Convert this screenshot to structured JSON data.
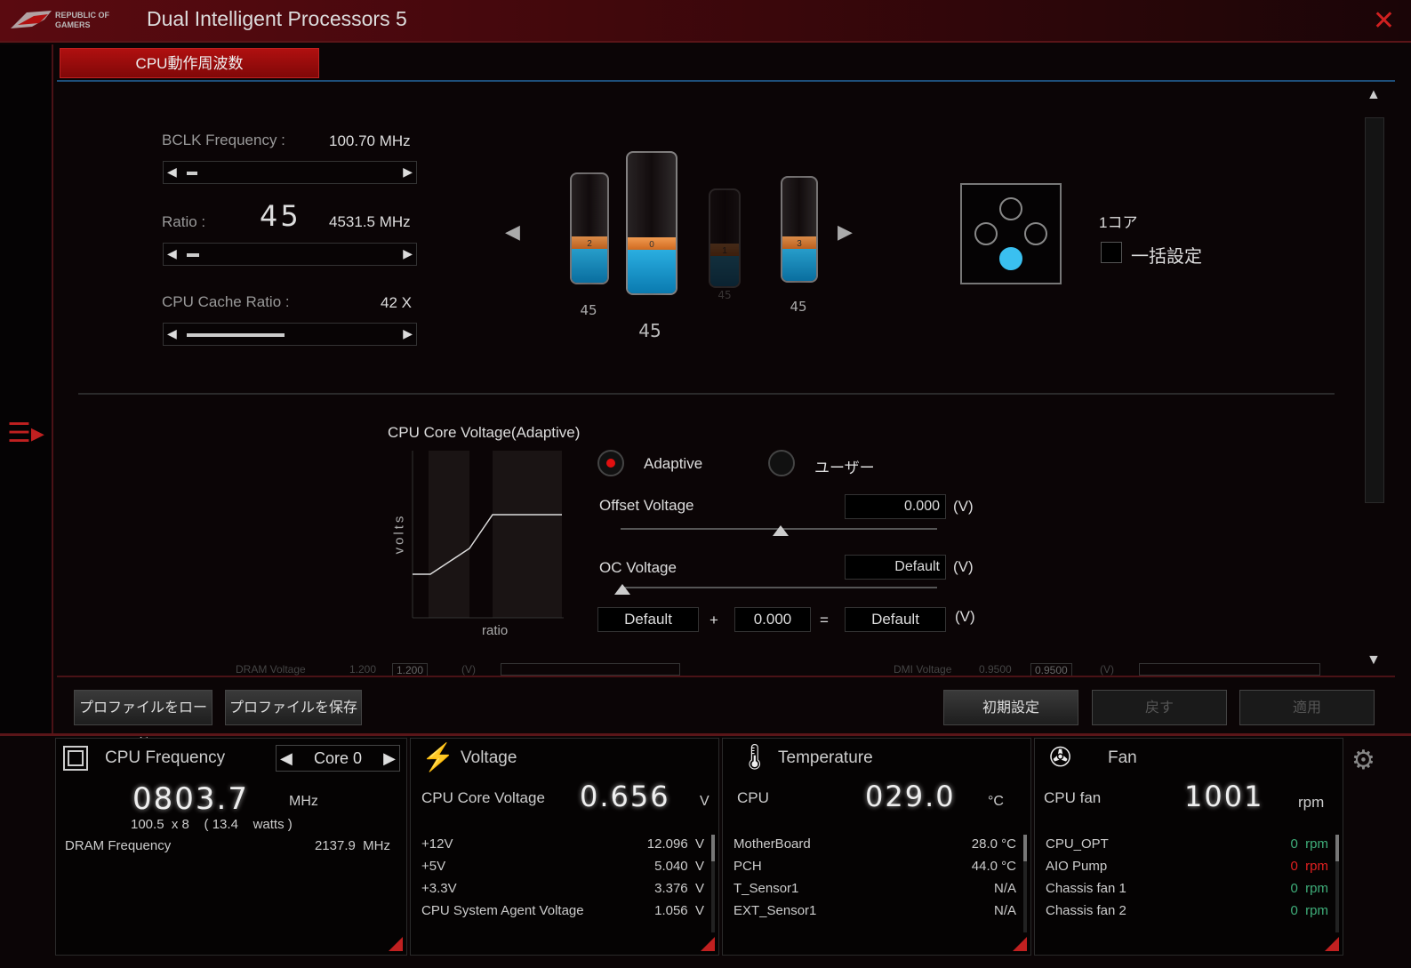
{
  "app": {
    "title": "Dual Intelligent Processors 5",
    "logo_line1": "REPUBLIC OF",
    "logo_line2": "GAMERS"
  },
  "tab": {
    "label": "CPU動作周波数"
  },
  "freq": {
    "bclk_label": "BCLK Frequency :",
    "bclk_value": "100.70 MHz",
    "ratio_label": "Ratio :",
    "ratio_value": "45",
    "ratio_mhz": "4531.5 MHz",
    "cache_label": "CPU Cache Ratio :",
    "cache_value": "42 X"
  },
  "cores": [
    {
      "index": "2",
      "ratio": "45",
      "fill": 0.3
    },
    {
      "index": "0",
      "ratio": "45",
      "fill": 0.3
    },
    {
      "index": "1",
      "ratio": "45",
      "fill": 0.3
    },
    {
      "index": "3",
      "ratio": "45",
      "fill": 0.3
    }
  ],
  "core_select": {
    "label": "1コア",
    "checkbox_label": "一括設定"
  },
  "voltage": {
    "title": "CPU Core Voltage(Adaptive)",
    "ylabel": "volts",
    "xlabel": "ratio",
    "mode_adaptive": "Adaptive",
    "mode_user": "ユーザー",
    "offset_label": "Offset Voltage",
    "offset_value": "0.000",
    "unit": "(V)",
    "oc_label": "OC Voltage",
    "oc_value": "Default",
    "sum_a": "Default",
    "plus": "+",
    "sum_b": "0.000",
    "equals": "=",
    "sum_c": "Default"
  },
  "cut_row": {
    "dram_label": "DRAM Voltage",
    "dram_value": "1.200",
    "dram_box": "1.200",
    "dmi_label": "DMI Voltage",
    "dmi_value": "0.9500",
    "dmi_box": "0.9500",
    "unit": "(V)"
  },
  "buttons": {
    "load": "プロファイルをロード",
    "save": "プロファイルを保存",
    "default": "初期設定",
    "undo": "戻す",
    "apply": "適用"
  },
  "monitor": {
    "cpu": {
      "title": "CPU Frequency",
      "core_sel": "Core 0",
      "value": "0803.7",
      "unit": "MHz",
      "detail": "100.5  x 8    ( 13.4    watts )",
      "dram_label": "DRAM Frequency",
      "dram_value": "2137.9  MHz"
    },
    "volt": {
      "title": "Voltage",
      "main_label": "CPU Core Voltage",
      "main_value": "0.656",
      "main_unit": "V",
      "rows": [
        {
          "label": "+12V",
          "value": "12.096  V"
        },
        {
          "label": "+5V",
          "value": "5.040  V"
        },
        {
          "label": "+3.3V",
          "value": "3.376  V"
        },
        {
          "label": "CPU System Agent Voltage",
          "value": "1.056  V"
        }
      ]
    },
    "temp": {
      "title": "Temperature",
      "main_label": "CPU",
      "main_value": "029.0",
      "main_unit": "°C",
      "rows": [
        {
          "label": "MotherBoard",
          "value": "28.0 °C"
        },
        {
          "label": "PCH",
          "value": "44.0 °C"
        },
        {
          "label": "T_Sensor1",
          "value": "N/A"
        },
        {
          "label": "EXT_Sensor1",
          "value": "N/A"
        }
      ]
    },
    "fan": {
      "title": "Fan",
      "main_label": "CPU fan",
      "main_value": "1001",
      "main_unit": "rpm",
      "rows": [
        {
          "label": "CPU_OPT",
          "value": "0  rpm",
          "color": "#3fae7a"
        },
        {
          "label": "AIO Pump",
          "value": "0  rpm",
          "color": "#e02020"
        },
        {
          "label": "Chassis fan 1",
          "value": "0  rpm",
          "color": "#3fae7a"
        },
        {
          "label": "Chassis fan 2",
          "value": "0  rpm",
          "color": "#3fae7a"
        }
      ]
    }
  }
}
